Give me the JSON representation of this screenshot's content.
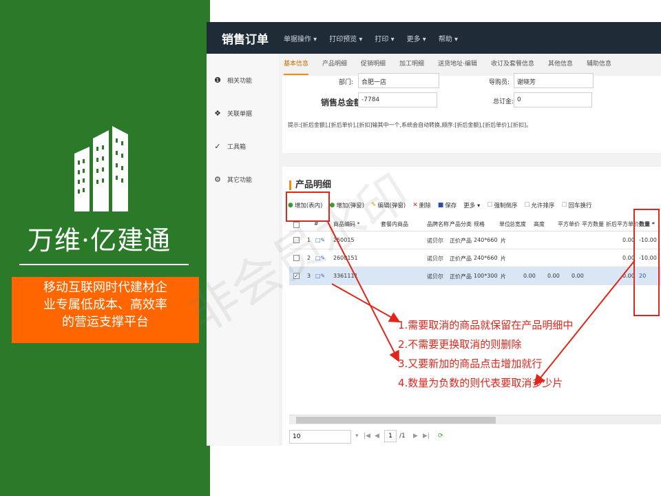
{
  "brand": {
    "name": "万维·亿建通",
    "slogan_lines": [
      "移动互联网时代建材企",
      "业专属低成本、高效率",
      "的营运支撑平台"
    ]
  },
  "app": {
    "title": "销售订单",
    "menu": [
      "单据操作 ▾",
      "打印预览 ▾",
      "打印 ▾",
      "更多 ▾",
      "帮助 ▾"
    ],
    "side": [
      {
        "icon": "info-icon",
        "label": "相关功能"
      },
      {
        "icon": "dropbox-icon",
        "label": "关联单据"
      },
      {
        "icon": "wrench-icon",
        "label": "工具箱"
      },
      {
        "icon": "gears-icon",
        "label": "其它功能"
      }
    ],
    "tabs": [
      "基本信息",
      "产品明细",
      "促销明细",
      "加工明细",
      "送货地址·编辑",
      "收订及套餐信息",
      "其他信息",
      "辅助信息"
    ]
  },
  "form": {
    "dept_label": "部门:",
    "dept_value": "合肥一店",
    "clerk_label": "导购员:",
    "clerk_value": "谢晓芳",
    "amount_label": "销售总金额:",
    "amount_value": "-7784",
    "deposit_label": "总订金:",
    "deposit_value": "0",
    "hint": "提示:[折后金额],[折后单价],[折扣]输其中一个,系统会自动转换,顺序:[折后金额],[折后单价],[折扣]。"
  },
  "detail": {
    "title": "产品明细",
    "toolbar": {
      "add_inline": "增加(表内)",
      "add_popup": "增加(弹窗)",
      "edit_popup": "编辑(弹窗)",
      "delete": "删除",
      "save": "保存",
      "more": "更多 ▾",
      "force_reverse": "强制倒序",
      "allow_sort": "允许排序",
      "enter_wrap": "回车换行"
    },
    "headers": [
      "#",
      "商品编码 *",
      "套餐内商品",
      "品牌名称",
      "产品分类",
      "规格",
      "单位",
      "总宽度",
      "高度",
      "平方单价",
      "平方数量",
      "折后平方单价",
      "数量 *"
    ],
    "rows": [
      {
        "num": "1",
        "code": "250015",
        "brand": "诺贝尔",
        "category": "正价产品",
        "spec": "240*660",
        "unit": "片",
        "width": "",
        "height": "",
        "sqprice": "",
        "disc": "0.00",
        "qty": "-10.00",
        "checked": false
      },
      {
        "num": "2",
        "code": "2600151",
        "brand": "诺贝尔",
        "category": "正价产品",
        "spec": "240*660",
        "unit": "片",
        "width": "",
        "height": "",
        "sqprice": "",
        "disc": "0.00",
        "qty": "-10.00",
        "checked": false
      },
      {
        "num": "3",
        "code": "3361111",
        "brand": "诺贝尔",
        "category": "正价产品",
        "spec": "100*300",
        "unit": "片",
        "width": "0.00",
        "height": "0.00",
        "sqprice": "0.00",
        "disc": "0.00",
        "qty": "20",
        "checked": true
      }
    ],
    "pager": {
      "size": "10",
      "page": "1",
      "total": "/1"
    }
  },
  "annotations": [
    "1.需要取消的商品就保留在产品明细中",
    "2.不需要更换取消的则删除",
    "3.又要新加的商品点击增加就行",
    "4.数量为负数的则代表要取消多少片"
  ],
  "watermark": "非会员水印",
  "colors": {
    "brand_green": "#2a7a2a",
    "slogan_orange": "#ff6600",
    "annot_red": "#e1251b",
    "topbar": "#1f2c38"
  }
}
